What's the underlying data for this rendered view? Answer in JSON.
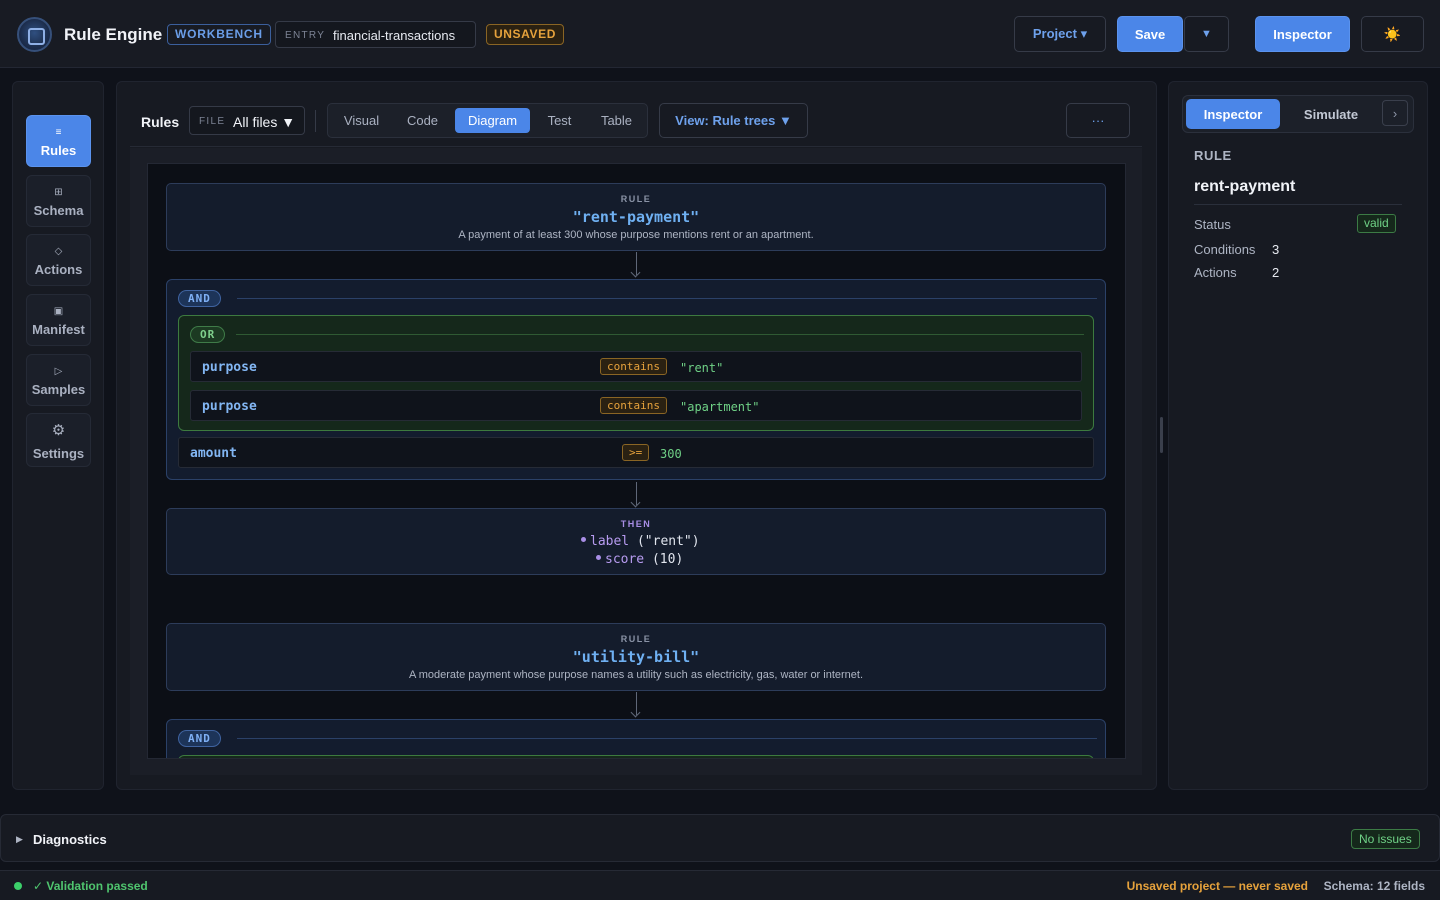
{
  "header": {
    "app_title": "Rule Engine",
    "workbench_tag": "WORKBENCH",
    "entry_key": "ENTRY",
    "entry_value": "financial-transactions",
    "unsaved_tag": "UNSAVED",
    "project_button": "Project ▾",
    "save_button": "Save",
    "save_menu_button": "▼",
    "inspector_button": "Inspector",
    "theme_button": "☀️"
  },
  "sidebar": {
    "items": [
      {
        "icon": "≡",
        "label": "Rules",
        "active": true
      },
      {
        "icon": "⊞",
        "label": "Schema"
      },
      {
        "icon": "◇",
        "label": "Actions"
      },
      {
        "icon": "▣",
        "label": "Manifest"
      },
      {
        "icon": "▷",
        "label": "Samples"
      },
      {
        "icon": "⚙",
        "label": "Settings"
      }
    ]
  },
  "toolbar": {
    "title": "Rules",
    "file_key": "FILE",
    "file_value": "All files ▼",
    "tabs": [
      "Visual",
      "Code",
      "Diagram",
      "Test",
      "Table"
    ],
    "active_tab": "Diagram",
    "view_button": "View: Rule trees ▼",
    "more_button": "···"
  },
  "diagram": {
    "rules": [
      {
        "kicker": "RULE",
        "name": "\"rent-payment\"",
        "description": "A payment of at least 300 whose purpose mentions rent or an apartment.",
        "and_label": "AND",
        "or_label": "OR",
        "or_conditions": [
          {
            "field": "purpose",
            "op": "contains",
            "value": "\"rent\""
          },
          {
            "field": "purpose",
            "op": "contains",
            "value": "\"apartment\""
          }
        ],
        "conditions": [
          {
            "field": "amount",
            "op": ">=",
            "value": "300"
          }
        ],
        "then_kicker": "THEN",
        "actions": [
          {
            "name": "label",
            "args": "(\"rent\")"
          },
          {
            "name": "score",
            "args": "(10)"
          }
        ]
      },
      {
        "kicker": "RULE",
        "name": "\"utility-bill\"",
        "description": "A moderate payment whose purpose names a utility such as electricity, gas, water or internet.",
        "and_label": "AND"
      }
    ]
  },
  "inspector": {
    "tabs": [
      "Inspector",
      "Simulate"
    ],
    "chevron": "›",
    "kicker": "RULE",
    "rule_name": "rent-payment",
    "status_label": "Status",
    "status_value": "valid",
    "conditions_label": "Conditions",
    "conditions_value": "3",
    "actions_label": "Actions",
    "actions_value": "2"
  },
  "diagnostics": {
    "caret": "▶",
    "title": "Diagnostics",
    "badge": "No issues"
  },
  "statusbar": {
    "validation": "✓ Validation passed",
    "unsaved": "Unsaved project — never saved",
    "schema": "Schema: 12 fields"
  },
  "colors": {
    "accent": "#4b86e8",
    "warning": "#e6a23c",
    "success": "#6fd186",
    "background": "#0f121a"
  }
}
